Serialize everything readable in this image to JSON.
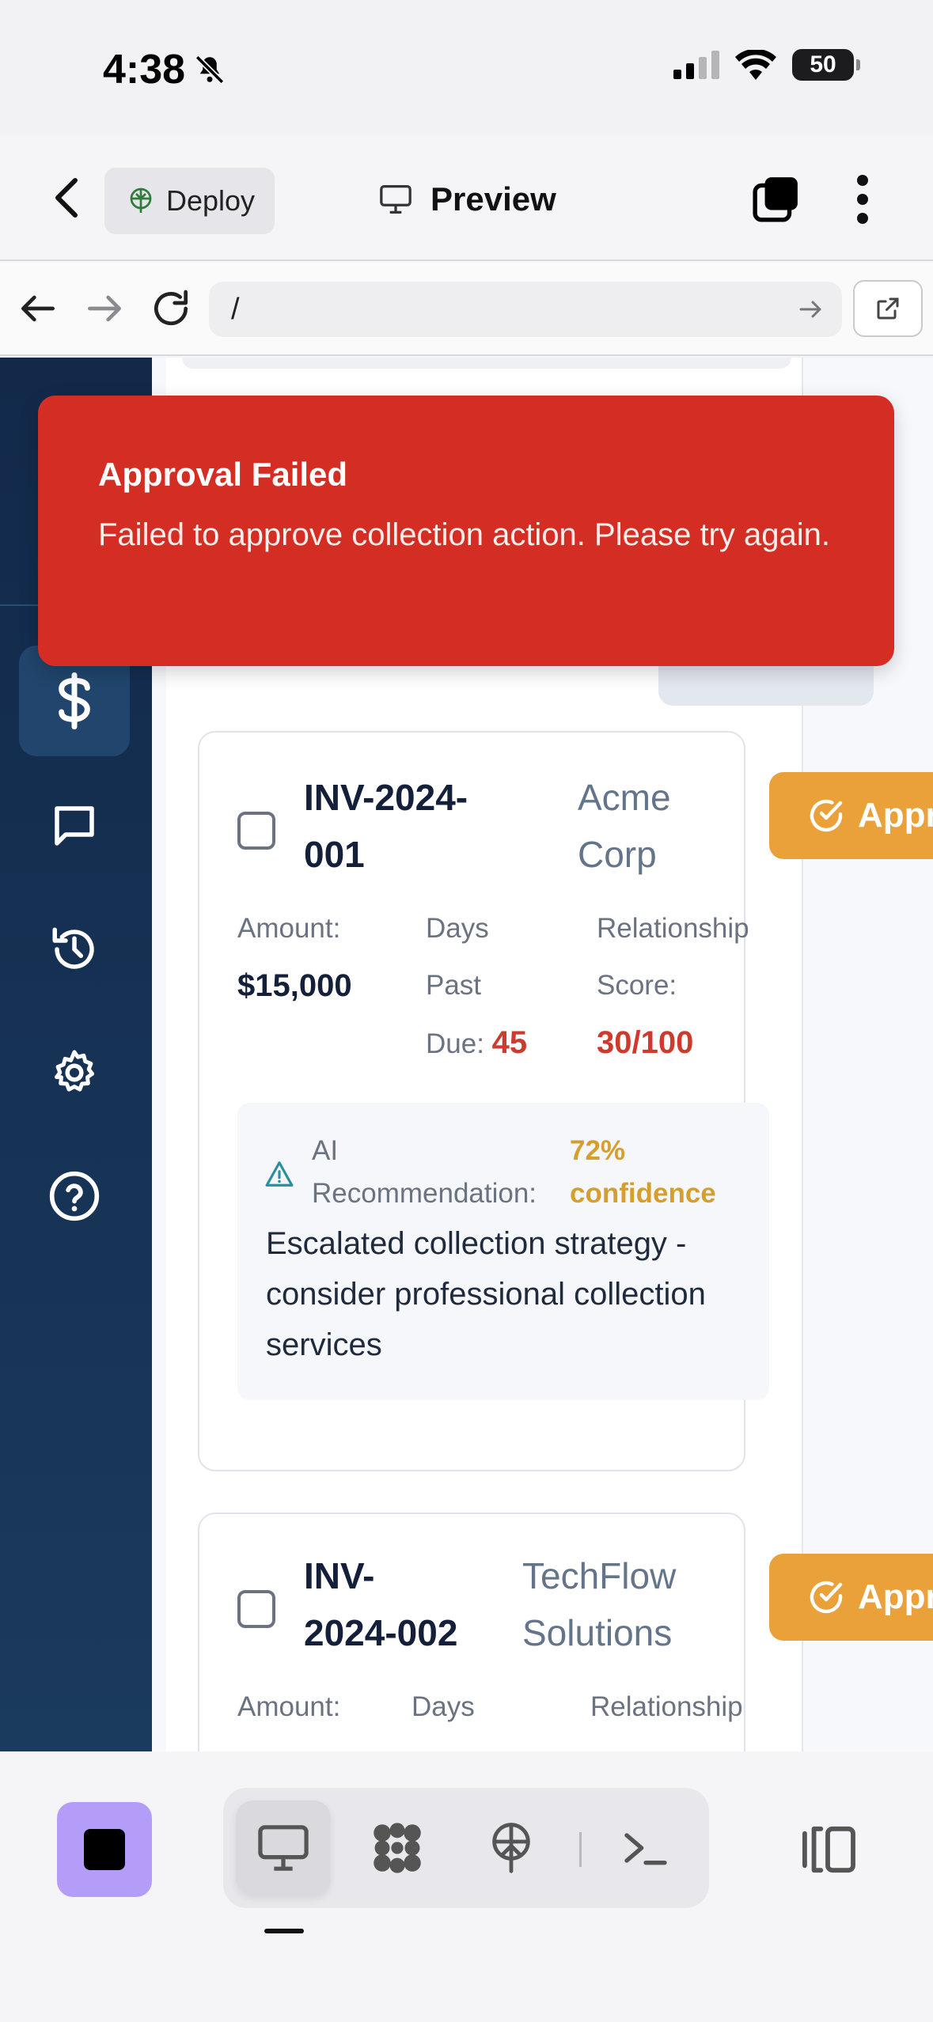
{
  "status_bar": {
    "time": "4:38",
    "battery": "50"
  },
  "app_bar": {
    "deploy_label": "Deploy",
    "title": "Preview"
  },
  "url_bar": {
    "url": "/"
  },
  "toast": {
    "title": "Approval Failed",
    "message": "Failed to approve collection action. Please try again."
  },
  "invoices": [
    {
      "id_line1": "INV-2024-",
      "id_line2": "001",
      "client_line1": "Acme",
      "client_line2": "Corp",
      "amount_label": "Amount:",
      "amount": "$15,000",
      "days_label_1": "Days",
      "days_label_2": "Past",
      "days_label_3": "Due:",
      "days": "45",
      "score_label_1": "Relationship",
      "score_label_2": "Score:",
      "score": "30/100",
      "ai_label_1": "AI",
      "ai_label_2": "Recommendation:",
      "ai_conf_1": "72%",
      "ai_conf_2": "confidence",
      "ai_text": "Escalated collection strategy - consider professional collection services",
      "approve_label": "Appr"
    },
    {
      "id_line1": "INV-",
      "id_line2": "2024-002",
      "client_line1": "TechFlow",
      "client_line2": "Solutions",
      "amount_label": "Amount:",
      "days_label_1": "Days",
      "score_label_1": "Relationship",
      "approve_label": "Appr"
    }
  ],
  "colors": {
    "toast": "#d42e24",
    "approve": "#eba13a",
    "sidebar": "#12294a",
    "danger_text": "#cf3a2e",
    "confidence": "#d69e2e",
    "stop_button": "#b39df8"
  },
  "icons": {
    "sidebar": [
      "dollar-icon",
      "chat-icon",
      "history-icon",
      "gear-icon",
      "help-icon"
    ],
    "bottom": [
      "stop-icon",
      "monitor-icon",
      "cluster-icon",
      "deploy-icon",
      "terminal-icon",
      "split-view-icon"
    ]
  }
}
